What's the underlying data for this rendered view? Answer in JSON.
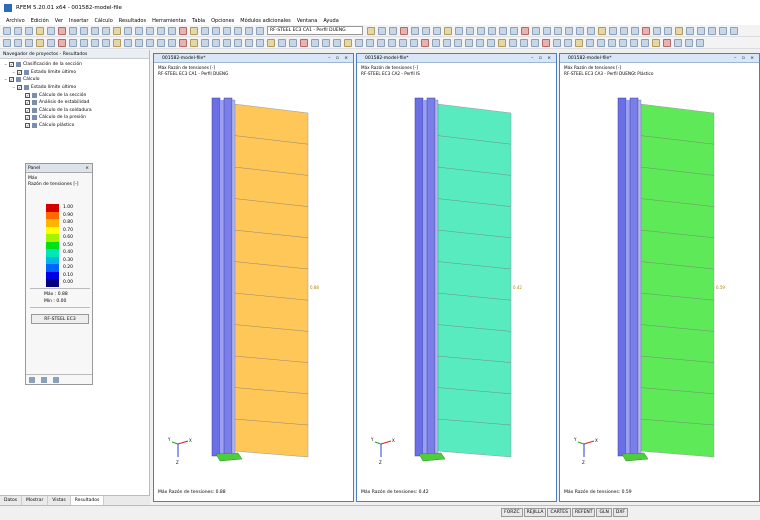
{
  "titlebar": {
    "title": "RFEM 5.20.01 x64 - 001582-model-file"
  },
  "menu": [
    "Archivo",
    "Edición",
    "Ver",
    "Insertar",
    "Cálculo",
    "Resultados",
    "Herramientas",
    "Tabla",
    "Opciones",
    "Módulos adicionales",
    "Ventana",
    "Ayuda"
  ],
  "toolbar": {
    "combo_value": "RF-STEEL EC3 CA1 - Perfil DUENG"
  },
  "navigator": {
    "header": "Navegador de proyectos - Resultados",
    "tree": [
      {
        "label": "Clasificación de la sección",
        "level": 0,
        "checked": true
      },
      {
        "label": "Estado límite último",
        "level": 1,
        "checked": true
      },
      {
        "label": "Cálculo",
        "level": 0,
        "checked": true
      },
      {
        "label": "Estado límite último",
        "level": 1,
        "checked": true
      },
      {
        "label": "Cálculo de la sección",
        "level": 2,
        "checked": true
      },
      {
        "label": "Análisis de estabilidad",
        "level": 2,
        "checked": true
      },
      {
        "label": "Cálculo de la soldadura",
        "level": 2,
        "checked": true
      },
      {
        "label": "Cálculo de la presión",
        "level": 2,
        "checked": true
      },
      {
        "label": "Cálculo plástico",
        "level": 2,
        "checked": true
      }
    ],
    "tabs": [
      {
        "label": "Datos",
        "active": false
      },
      {
        "label": "Mostrar",
        "active": false
      },
      {
        "label": "Vistas",
        "active": false
      },
      {
        "label": "Resultados",
        "active": true
      }
    ]
  },
  "panel": {
    "title": "Panel",
    "close": "×",
    "subtitle1": "Máx",
    "subtitle2": "Razón de tensiones [-]",
    "legend": [
      {
        "value": "1.00",
        "color": "#d40000"
      },
      {
        "value": "0.90",
        "color": "#ff6a00"
      },
      {
        "value": "0.80",
        "color": "#ffb400"
      },
      {
        "value": "0.70",
        "color": "#ffff00"
      },
      {
        "value": "0.60",
        "color": "#a4f200"
      },
      {
        "value": "0.50",
        "color": "#00e01a"
      },
      {
        "value": "0.40",
        "color": "#00e6b4"
      },
      {
        "value": "0.30",
        "color": "#00b8e6"
      },
      {
        "value": "0.20",
        "color": "#0064ff"
      },
      {
        "value": "0.10",
        "color": "#0000e6"
      },
      {
        "value": "0.00",
        "color": "#00007a"
      }
    ],
    "max_label": "Máx :",
    "max_value": "0.88",
    "min_label": "Mín :",
    "min_value": "0.00",
    "button": "RF-STEEL EC3"
  },
  "windows": [
    {
      "title": "001582-model-file*",
      "line1": "Máx Razón de tensiones [-]",
      "line2": "RF-STEEL EC3 CA1 - Perfil DUENG",
      "footer": "Máx Razón de tensiones: 0.88",
      "value_label": "0.88",
      "fill": "#ffbe3c"
    },
    {
      "title": "001582-model-file*",
      "line1": "Máx Razón de tensiones [-]",
      "line2": "RF-STEEL EC3 CA2 - Perfil IS",
      "footer": "Máx Razón de tensiones: 0.42",
      "value_label": "0.42",
      "fill": "#3ce8b4"
    },
    {
      "title": "001582-model-file*",
      "line1": "Máx Razón de tensiones [-]",
      "line2": "RF-STEEL EC3 CA3 - Perfil DUENGt Plástico",
      "footer": "Máx Razón de tensiones: 0.59",
      "value_label": "0.59",
      "fill": "#42e63c"
    }
  ],
  "axes": {
    "x": "X",
    "y": "Y",
    "z": "Z"
  },
  "statusbar": {
    "tabs": [
      "FORZC",
      "REJILLA",
      "CARTES",
      "REFENT",
      "GLN",
      "DXF"
    ]
  }
}
